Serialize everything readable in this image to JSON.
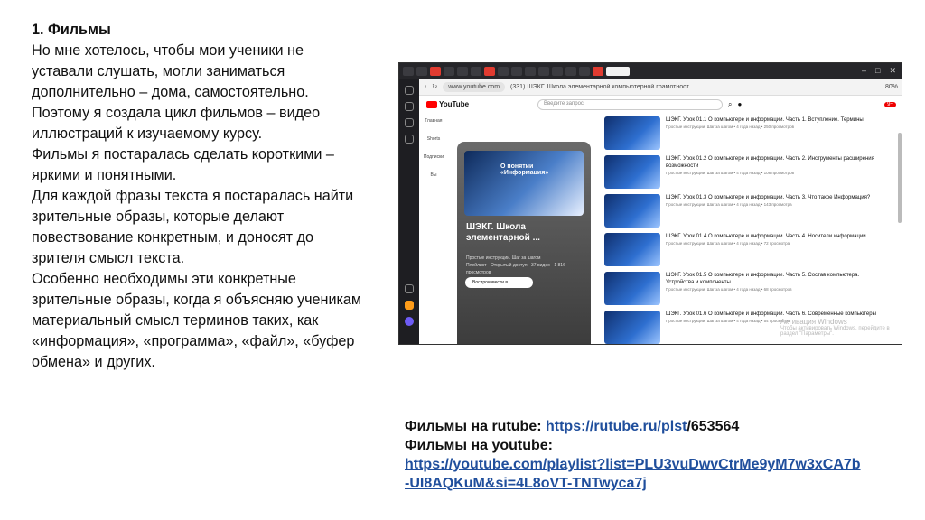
{
  "slide": {
    "heading": "1. Фильмы",
    "paragraphs": [
      "Но мне хотелось, чтобы мои ученики не\nуставали слушать, могли заниматься\nдополнительно – дома, самостоятельно.\nПоэтому я создала цикл фильмов – видео\nиллюстраций к изучаемому курсу.",
      "Фильмы я постаралась сделать короткими –\nяркими и понятными.",
      "Для каждой фразы текста я постаралась найти\nзрительные образы, которые делают\nповествование конкретным, и доносят до\nзрителя смысл текста.",
      "Особенно необходимы эти конкретные\nзрительные образы, когда я объясняю ученикам\nматериальный смысл терминов таких, как\n«информация», «программа», «файл», «буфер\nобмена» и других."
    ]
  },
  "screenshot": {
    "address": {
      "url": "www.youtube.com",
      "tab_title": "(331) ШЭКГ. Школа элементарной компьютерной грамотност...",
      "zoom": "80%"
    },
    "youtube": {
      "logo": "YouTube",
      "search_placeholder": "Введите запрос",
      "notifications": "9+",
      "side_nav": [
        "Главная",
        "Shorts",
        "Подписки",
        "Вы"
      ]
    },
    "playlist": {
      "title": "ШЭКГ. Школа элементарной ...",
      "thumb_text": "О понятии «Информация»",
      "channel": "Простые инструкции. Шаг за шагом",
      "meta": "Плейлист · Открытый доступ · 37 видео · 1 816 просмотров",
      "play_label": "Воспроизвести в..."
    },
    "videos": [
      {
        "title": "ШЭКГ. Урок 01.1 О компьютере и информации. Часть 1. Вступление. Термины",
        "meta": "Простые инструкции. Шаг за шагом • 4 года назад • 250 просмотров"
      },
      {
        "title": "ШЭКГ. Урок 01.2 О компьютере и информации. Часть 2. Инструменты расширения возможности",
        "meta": "Простые инструкции. Шаг за шагом • 4 года назад • 108 просмотров"
      },
      {
        "title": "ШЭКГ. Урок 01.3 О компьютере и информации. Часть 3. Что такое Информация?",
        "meta": "Простые инструкции. Шаг за шагом • 4 года назад • 143 просмотра"
      },
      {
        "title": "ШЭКГ. Урок 01.4 О компьютере и информации. Часть 4. Носители информации",
        "meta": "Простые инструкции. Шаг за шагом • 4 года назад • 72 просмотра"
      },
      {
        "title": "ШЭКГ. Урок 01.5 О компьютере и информации. Часть 5. Состав компьютера. Устройства и компоненты",
        "meta": "Простые инструкции. Шаг за шагом • 4 года назад • 68 просмотров"
      },
      {
        "title": "ШЭКГ. Урок 01.6 О компьютере и информации. Часть 6. Современные компьютеры",
        "meta": "Простые инструкции. Шаг за шагом • 4 года назад • 54 просмотра"
      }
    ],
    "activation": {
      "line1": "Активация Windows",
      "line2": "Чтобы активировать Windows, перейдите в раздел \"Параметры\"."
    }
  },
  "links": {
    "rutube_label": "Фильмы на rutube:",
    "rutube_url_part1": "https://rutube.ru/plst",
    "rutube_url_part2": "/653564",
    "youtube_label": "Фильмы на youtube:",
    "youtube_url_line1": "https://youtube.com/playlist?list=PLU3vuDwvCtrMe9yM7w3xCA7b",
    "youtube_url_line2": "-UI8AQKuM&si=4L8oVT-TNTwyca7j"
  }
}
